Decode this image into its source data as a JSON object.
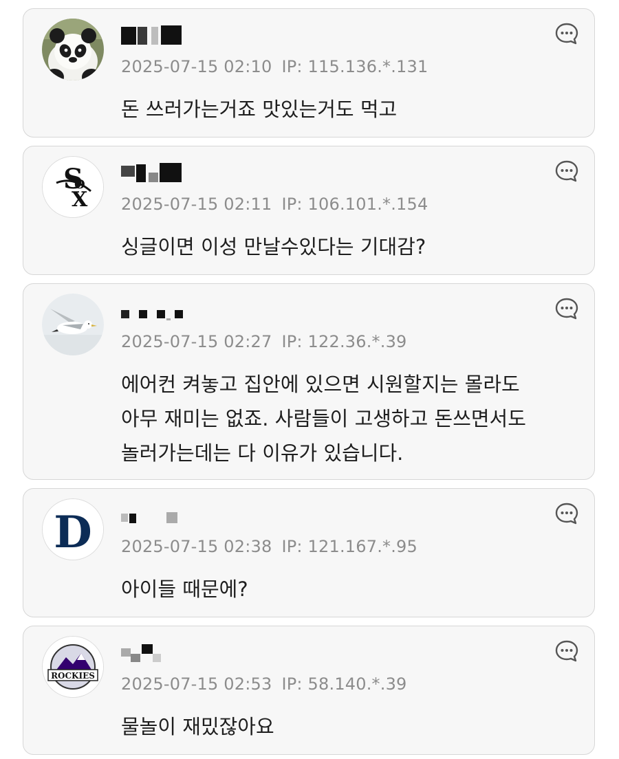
{
  "comments": [
    {
      "avatar": "panda-avatar",
      "timestamp": "2025-07-15 02:10",
      "ip": "IP: 115.136.*.131",
      "text": [
        "돈 쓰러가는거죠 맛있는거도 먹고"
      ]
    },
    {
      "avatar": "white-sox-logo",
      "timestamp": "2025-07-15 02:11",
      "ip": "IP: 106.101.*.154",
      "text": [
        "싱글이면 이성 만날수있다는 기대감?"
      ]
    },
    {
      "avatar": "seagull-avatar",
      "timestamp": "2025-07-15 02:27",
      "ip": "IP: 122.36.*.39",
      "text": [
        "에어컨 켜놓고 집안에 있으면 시원할지는 몰라도",
        "아무 재미는 없죠. 사람들이 고생하고 돈쓰면서도",
        "놀러가는데는 다 이유가 있습니다."
      ]
    },
    {
      "avatar": "tigers-logo",
      "timestamp": "2025-07-15 02:38",
      "ip": "IP: 121.167.*.95",
      "text": [
        "아이들 때문에?"
      ]
    },
    {
      "avatar": "rockies-logo",
      "timestamp": "2025-07-15 02:53",
      "ip": "IP: 58.140.*.39",
      "text": [
        "물놀이 재밌잖아요"
      ]
    }
  ],
  "colors": {
    "card_background": "#f7f7f7",
    "card_border": "#d6d6d6",
    "meta_text": "#8c8c8c",
    "body_text": "#1e1e1e",
    "reply_icon": "#555555"
  },
  "icons": {
    "reply": "comment-bubble-icon",
    "nickname": "blurred-nickname"
  }
}
